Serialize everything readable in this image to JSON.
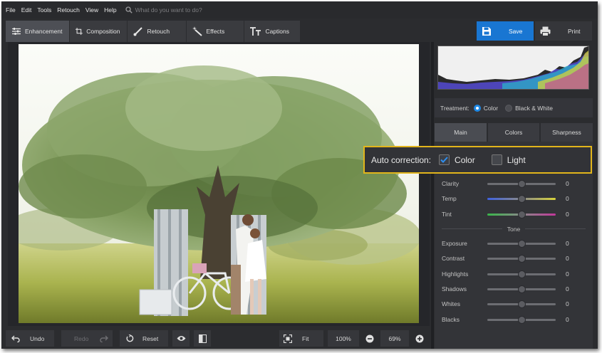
{
  "menu": {
    "items": [
      "File",
      "Edit",
      "Tools",
      "Retouch",
      "View",
      "Help"
    ]
  },
  "search": {
    "placeholder": "What do you want to do?"
  },
  "toolbar": {
    "tabs": [
      {
        "label": "Enhancement",
        "icon": "sliders-icon"
      },
      {
        "label": "Composition",
        "icon": "crop-icon"
      },
      {
        "label": "Retouch",
        "icon": "brush-icon"
      },
      {
        "label": "Effects",
        "icon": "magic-wand-icon"
      },
      {
        "label": "Captions",
        "icon": "text-icon"
      }
    ],
    "active_tab": "Enhancement",
    "save_label": "Save",
    "print_label": "Print"
  },
  "treatment": {
    "label": "Treatment:",
    "options": [
      "Color",
      "Black & White"
    ],
    "selected": "Color"
  },
  "subtabs": {
    "items": [
      "Main",
      "Colors",
      "Sharpness"
    ],
    "active": "Main"
  },
  "auto_correction": {
    "label": "Auto correction:",
    "color_label": "Color",
    "light_label": "Light",
    "color_checked": true,
    "light_checked": false
  },
  "sliders": {
    "basic": [
      {
        "label": "Clarity",
        "value": "0"
      },
      {
        "label": "Temp",
        "value": "0"
      },
      {
        "label": "Tint",
        "value": "0"
      }
    ],
    "tone_header": "Tone",
    "tone": [
      {
        "label": "Exposure",
        "value": "0"
      },
      {
        "label": "Contrast",
        "value": "0"
      },
      {
        "label": "Highlights",
        "value": "0"
      },
      {
        "label": "Shadows",
        "value": "0"
      },
      {
        "label": "Whites",
        "value": "0"
      },
      {
        "label": "Blacks",
        "value": "0"
      }
    ]
  },
  "bottom": {
    "undo": "Undo",
    "redo": "Redo",
    "reset": "Reset",
    "fit": "Fit",
    "zoom_100": "100%",
    "zoom_value": "69%"
  },
  "colors": {
    "accent": "#1976d2",
    "highlight": "#e2b51b",
    "panel": "#333438"
  }
}
